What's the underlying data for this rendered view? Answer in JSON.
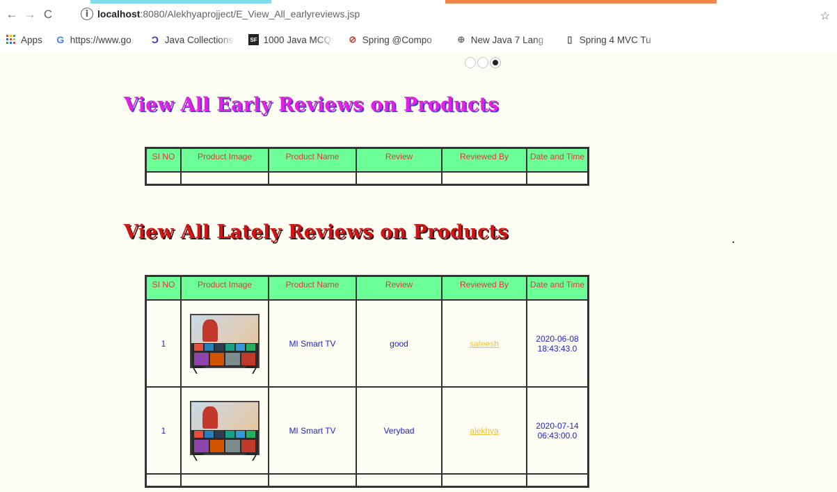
{
  "browser": {
    "url_host": "localhost",
    "url_path": ":8080/Alekhyaprojject/E_View_All_earlyreviews.jsp",
    "bookmarks": [
      {
        "icon": "apps-grid-icon",
        "label": "Apps"
      },
      {
        "icon": "google-icon",
        "label": "https://www.go"
      },
      {
        "icon": "javacollections-icon",
        "label": "Java Collections"
      },
      {
        "icon": "sanfoundry-icon",
        "label": "1000 Java MCQs"
      },
      {
        "icon": "spring-icon",
        "label": "Spring @Compo"
      },
      {
        "icon": "globe-icon",
        "label": "New Java 7 Lang"
      },
      {
        "icon": "page-icon",
        "label": "Spring 4 MVC Tu"
      }
    ]
  },
  "carousel": {
    "slides": 3,
    "active_index": 2
  },
  "early": {
    "title": "View All Early Reviews on Products",
    "headers": [
      "SI NO",
      "Product Image",
      "Product Name",
      "Review",
      "Reviewed By",
      "Date and Time"
    ]
  },
  "lately": {
    "title": "View All Lately Reviews on Products",
    "headers": [
      "SI NO",
      "Product Image",
      "Product Name",
      "Review",
      "Reviewed By",
      "Date and Time"
    ],
    "rows": [
      {
        "si": "1",
        "product": "MI Smart TV",
        "review": "good",
        "user": "sateesh",
        "date": "2020-06-08",
        "time": "18:43:43.0"
      },
      {
        "si": "1",
        "product": "MI Smart TV",
        "review": "Verybad",
        "user": "alekhya",
        "date": "2020-07-14",
        "time": "06:43:00.0"
      }
    ]
  },
  "colors": {
    "header_bg": "#6dff97",
    "header_text": "#e53535",
    "cell_text": "#2222dd",
    "user_link": "#f0c040",
    "early_title": "#e51fe5",
    "lately_title": "#d11414"
  }
}
